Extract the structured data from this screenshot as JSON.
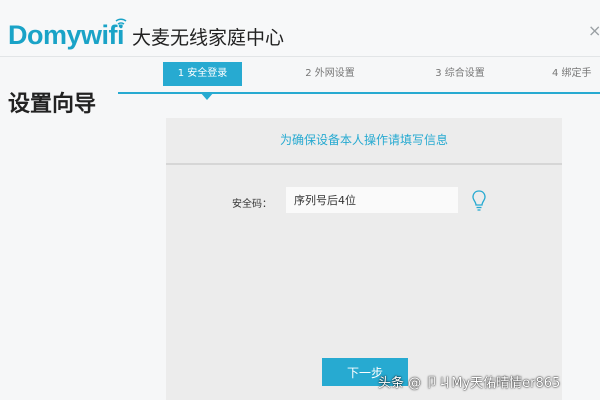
{
  "header": {
    "logo_text": "Domywifi",
    "product_title": "大麦无线家庭中心",
    "close_symbol": "×"
  },
  "steps": [
    {
      "label": "1 安全登录",
      "active": true
    },
    {
      "label": "2 外网设置",
      "active": false
    },
    {
      "label": "3 综合设置",
      "active": false
    },
    {
      "label": "4 绑定手",
      "active": false
    }
  ],
  "wizard_title": "设置向导",
  "panel": {
    "title": "为确保设备本人操作请填写信息",
    "field_label": "安全码：",
    "field_value": "序列号后4位",
    "next_label": "下一步"
  },
  "watermark": "头条 @ 卩ㄐMy天佑晴情er865",
  "colors": {
    "accent": "#27aad1",
    "panel_bg": "#ececec",
    "page_bg": "#f6f7f8"
  },
  "icons": {
    "wifi": "wifi-icon",
    "bulb": "bulb-icon",
    "close": "close-icon"
  }
}
